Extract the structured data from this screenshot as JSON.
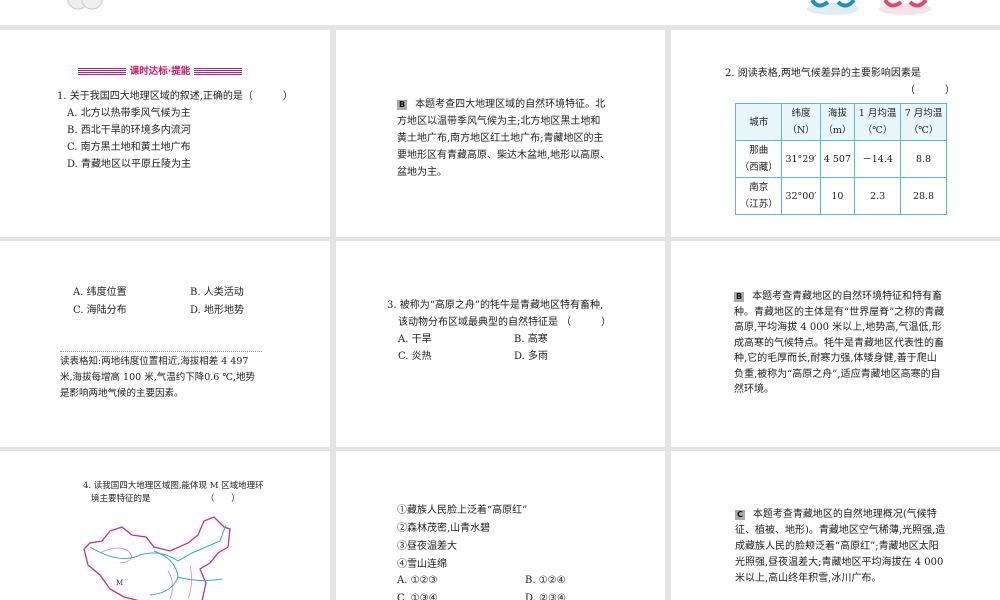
{
  "header": {
    "section_title": "课时达标·提能"
  },
  "q1": {
    "stem": "1. 关于我国四大地理区域的叙述,正确的是（　　　）",
    "options": [
      "A. 北方以热带季风气候为主",
      "B. 西北干旱的环境多内流河",
      "C. 南方黑土地和黄土地广布",
      "D. 青藏地区以平原丘陵为主"
    ]
  },
  "q1_answer": {
    "letter": "B",
    "lines": [
      "本题考查四大地理区域的自然环境特征。北",
      "方地区以温带季风气候为主;北方地区黑土地和",
      "黄土地广布,南方地区红土地广布;青藏地区的主",
      "要地形区有青藏高原、柴达木盆地,地形以高原、",
      "盆地为主。"
    ]
  },
  "q2": {
    "stem": "2. 阅读表格,两地气候差异的主要影响因素是",
    "paren": "（　　　）",
    "table": {
      "headers": [
        [
          "城市",
          ""
        ],
        [
          "纬度",
          "（N）"
        ],
        [
          "海拔",
          "（m）"
        ],
        [
          "1 月均温",
          "（℃）"
        ],
        [
          "7 月均温",
          "（℃）"
        ]
      ],
      "rows": [
        {
          "city": "那曲",
          "region": "（西藏）",
          "lat": "31°29′",
          "alt": "4 507",
          "jan": "－14.4",
          "jul": "8.8"
        },
        {
          "city": "南京",
          "region": "（江苏）",
          "lat": "32°00′",
          "alt": "10",
          "jan": "2.3",
          "jul": "28.8"
        }
      ]
    },
    "options": [
      "A. 纬度位置",
      "B. 人类活动",
      "C. 海陆分布",
      "D. 地形地势"
    ],
    "explain": [
      "读表格知:两地纬度位置相近,海拔相差 4 497",
      "米,海拔每增高 100 米,气温约下降0.6 ℃,地势",
      "是影响两地气候的主要因素。"
    ]
  },
  "q3": {
    "stem": [
      "3. 被称为“高原之舟”的牦牛是青藏地区特有畜种,",
      "该动物分布区域最典型的自然特征是 （　　　）"
    ],
    "options": [
      "A. 干旱",
      "B. 高寒",
      "C. 炎热",
      "D. 多雨"
    ]
  },
  "q3_answer": {
    "letter": "B",
    "lines": [
      "本题考查青藏地区的自然环境特征和特有畜",
      "种。青藏地区的主体是有“世界屋脊”之称的青藏",
      "高原,平均海拔 4 000 米以上,地势高,气温低,形",
      "成高寒的气候特点。牦牛是青藏地区代表性的畜",
      "种,它的毛厚而长,耐寒力强,体矮身健,善于爬山",
      "负重,被称为“高原之舟”,适应青藏地区高寒的自",
      "然环境。"
    ]
  },
  "q4": {
    "stem": [
      "4. 读我国四大地理区域图,能体现 M 区域地理环",
      "境主要特征的是　　　　　　　（　　）"
    ],
    "map_label": "M",
    "items": [
      "①藏族人民脸上泛着“高原红”",
      "②森林茂密,山青水碧",
      "③昼夜温差大",
      "④雪山连绵"
    ],
    "options": [
      "A. ①②③",
      "B. ①②④",
      "C. ①③④",
      "D. ②③④"
    ]
  },
  "q4_answer": {
    "letter": "C",
    "lines": [
      "本题考查青藏地区的自然地理概况(气候特",
      "征、植被、地形)。青藏地区空气稀薄,光照强,造",
      "成藏族人民的脸颊泛着“高原红”;青藏地区太阳",
      "光照强,昼夜温差大;青藏地区平均海拔在 4 000",
      "米以上,高山终年积雪,冰川广布。"
    ]
  }
}
